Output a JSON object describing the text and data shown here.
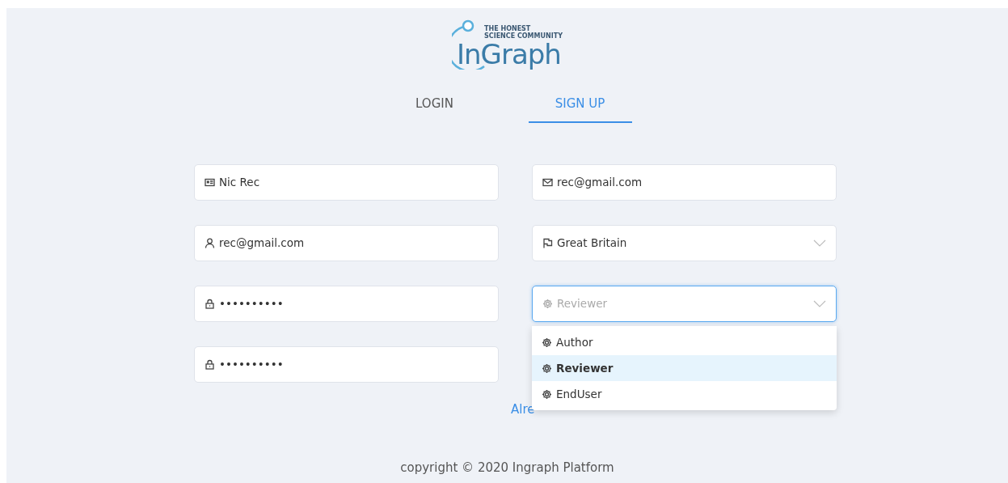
{
  "logo": {
    "tagline_1": "THE HONEST",
    "tagline_2": "SCIENCE COMMUNITY",
    "name": "InGraph"
  },
  "tabs": [
    {
      "label": "LOGIN",
      "selected": false
    },
    {
      "label": "SIGN UP",
      "selected": true
    }
  ],
  "fields": [
    {
      "kind": "text",
      "value": "Nic Rec"
    },
    {
      "kind": "text",
      "value": "rec@gmail.com"
    },
    {
      "kind": "text",
      "value": "rec@gmail.com"
    },
    {
      "kind": "select",
      "value": "Great Britain",
      "expanded": false
    },
    {
      "kind": "password",
      "value": "••••••••••"
    },
    {
      "kind": "select",
      "placeholder": "Reviewer",
      "expanded": true,
      "options": [
        {
          "label": "Author",
          "selected": false
        },
        {
          "label": "Reviewer",
          "selected": true
        },
        {
          "label": "EndUser",
          "selected": false
        }
      ]
    },
    {
      "kind": "password",
      "value": "••••••••••"
    }
  ],
  "account_link": "Alre",
  "footer": "copyright © 2020 Ingraph Platform"
}
